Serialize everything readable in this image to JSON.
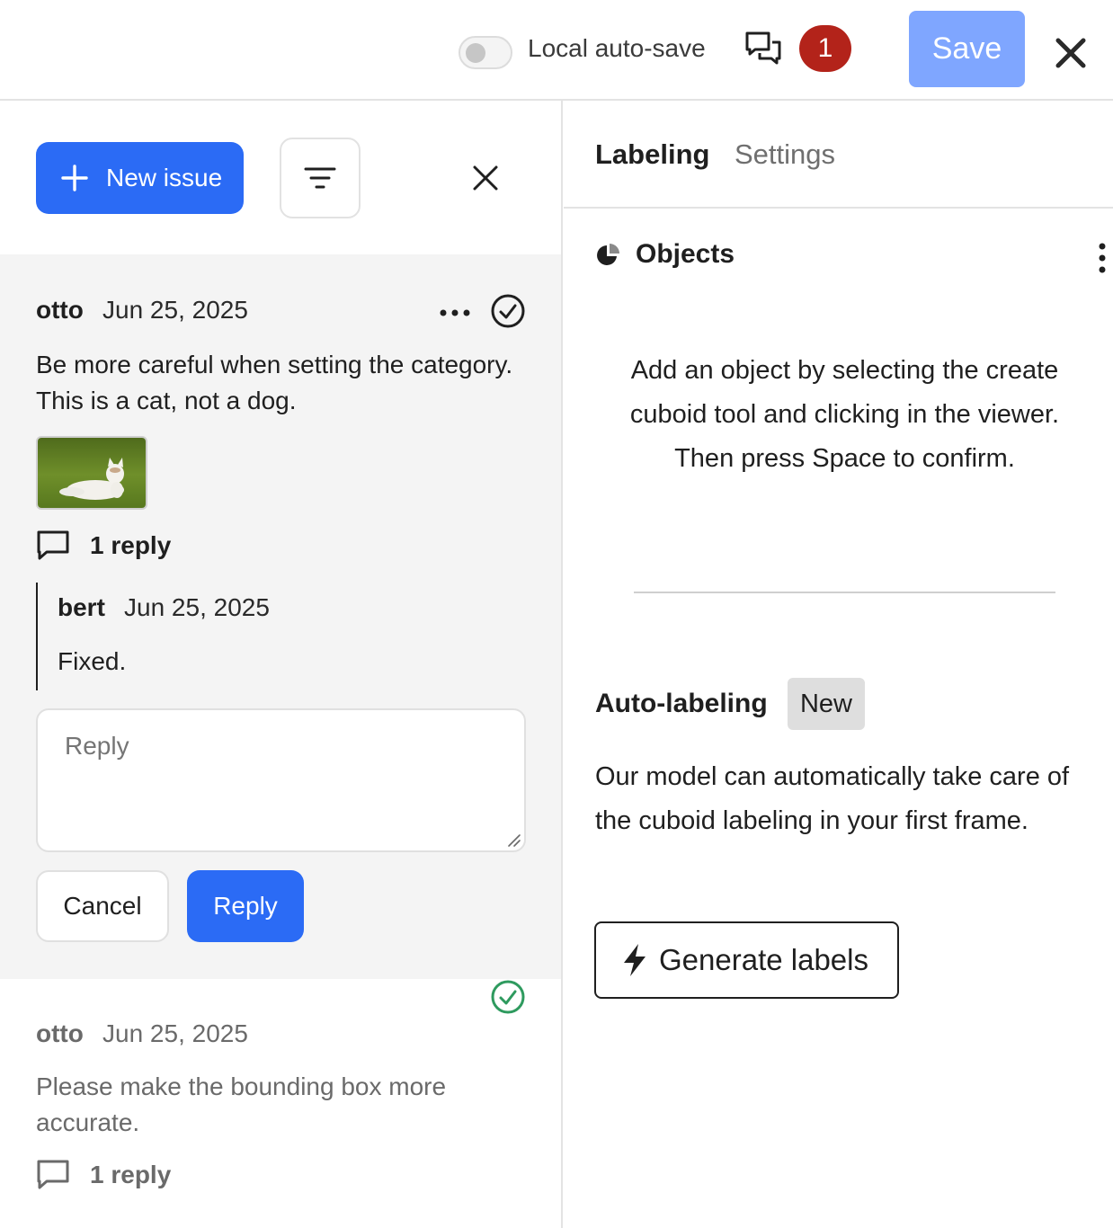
{
  "topbar": {
    "autosave_label": "Local auto-save",
    "autosave_on": false,
    "issue_count": "1",
    "save_label": "Save"
  },
  "issues_panel": {
    "new_issue_label": "New issue",
    "issues": [
      {
        "author": "otto",
        "date": "Jun 25, 2025",
        "text": "Be more careful when setting the category. This is a cat, not a dog.",
        "reply_count": "1 reply",
        "replies": [
          {
            "author": "bert",
            "date": "Jun 25, 2025",
            "text": "Fixed."
          }
        ],
        "reply_placeholder": "Reply",
        "cancel_label": "Cancel",
        "reply_label": "Reply"
      },
      {
        "author": "otto",
        "date": "Jun 25, 2025",
        "text": "Please make the bounding box more accurate.",
        "reply_count": "1 reply"
      }
    ]
  },
  "sidebar": {
    "tabs": [
      {
        "label": "Labeling",
        "active": true
      },
      {
        "label": "Settings",
        "active": false
      }
    ],
    "objects_title": "Objects",
    "objects_empty": "Add an object by selecting the create cuboid tool and clicking in the viewer. Then press Space to confirm.",
    "autolabel_title": "Auto-labeling",
    "autolabel_badge": "New",
    "autolabel_desc": "Our model can automatically take care of the cuboid labeling in your first frame.",
    "generate_label": "Generate labels"
  },
  "colors": {
    "primary": "#2b6bf5",
    "save_disabled": "#7fa6ff",
    "badge_red": "#b3231a",
    "resolved_green": "#2e9a5e"
  }
}
